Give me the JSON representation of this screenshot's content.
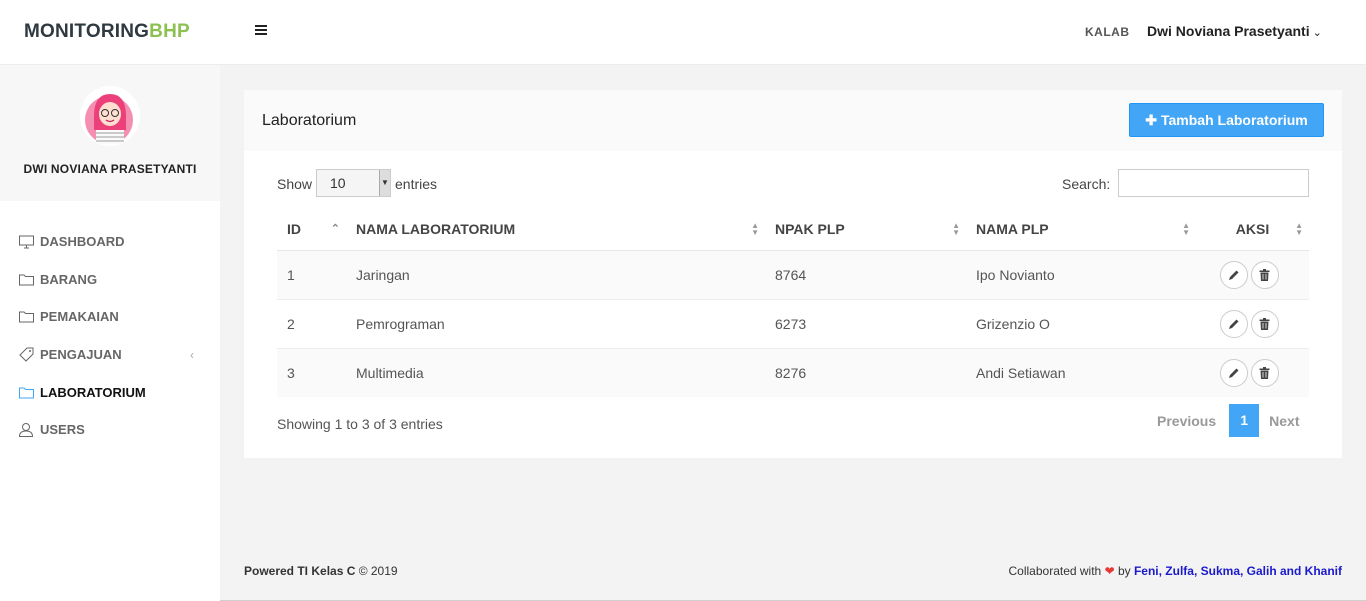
{
  "brand": {
    "part1": "MONITORING",
    "part2": "BHP"
  },
  "header": {
    "role": "KALAB",
    "user_name": "Dwi Noviana Prasetyanti"
  },
  "sidebar": {
    "profile_name": "DWI NOVIANA PRASETYANTI",
    "items": [
      {
        "label": "DASHBOARD",
        "icon": "monitor-icon"
      },
      {
        "label": "BARANG",
        "icon": "folder-icon"
      },
      {
        "label": "PEMAKAIAN",
        "icon": "folder-icon"
      },
      {
        "label": "PENGAJUAN",
        "icon": "tag-icon"
      },
      {
        "label": "LABORATORIUM",
        "icon": "folder-icon",
        "active": true
      },
      {
        "label": "USERS",
        "icon": "user-icon"
      }
    ]
  },
  "main": {
    "title": "Laboratorium",
    "add_button": "Tambah Laboratorium",
    "show_label": "Show",
    "page_size": "10",
    "entries_label": "entries",
    "search_label": "Search:",
    "search_value": "",
    "columns": [
      "ID",
      "NAMA LABORATORIUM",
      "NPAK PLP",
      "NAMA PLP",
      "AKSI"
    ],
    "rows": [
      {
        "id": "1",
        "nama": "Jaringan",
        "npak": "8764",
        "plp": "Ipo Novianto"
      },
      {
        "id": "2",
        "nama": "Pemrograman",
        "npak": "6273",
        "plp": "Grizenzio O"
      },
      {
        "id": "3",
        "nama": "Multimedia",
        "npak": "8276",
        "plp": "Andi Setiawan"
      }
    ],
    "info": "Showing 1 to 3 of 3 entries",
    "pagination": {
      "previous": "Previous",
      "current": "1",
      "next": "Next"
    }
  },
  "footer": {
    "left_bold": "Powered TI Kelas C",
    "left_rest": " © 2019",
    "right_prefix": "Collaborated with ",
    "right_by": " by ",
    "team": "Feni, Zulfa, Sukma, Galih and Khanif"
  },
  "colors": {
    "accent": "#42a5f5",
    "brand_green": "#8cc152",
    "heart": "#e53935",
    "team_link": "#1a1acc"
  }
}
